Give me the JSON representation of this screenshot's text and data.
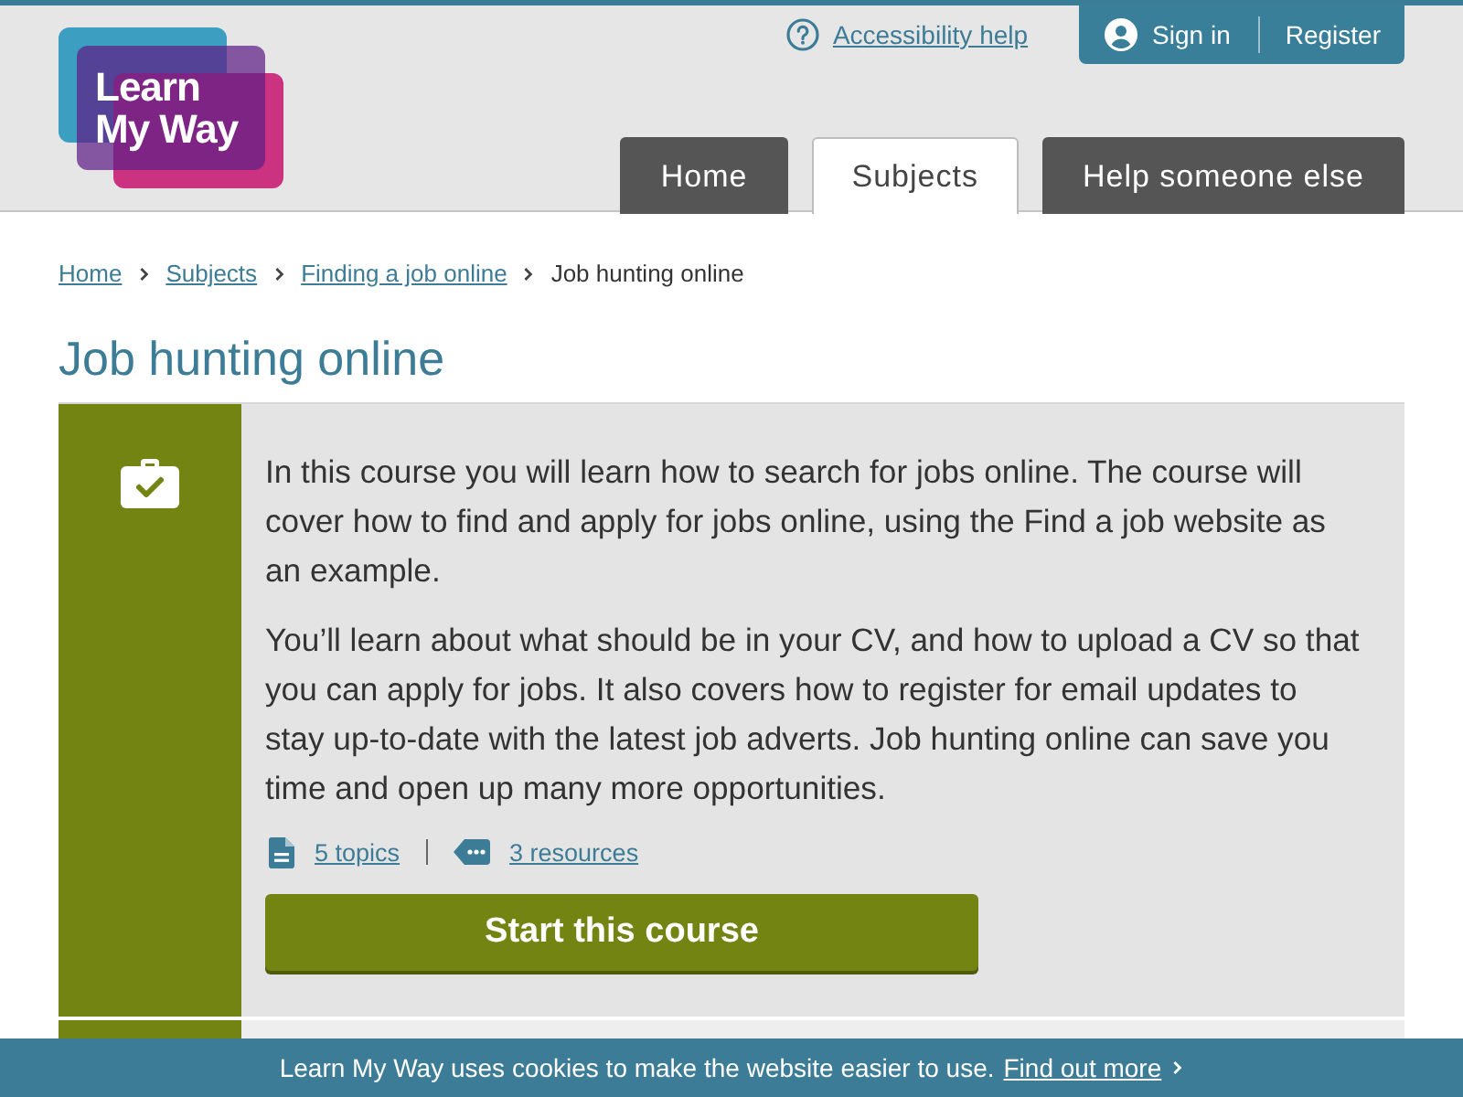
{
  "header": {
    "logo": {
      "lines": [
        "Learn",
        "My Way"
      ]
    },
    "accessibility_link": "Accessibility help",
    "account": {
      "sign_in": "Sign in",
      "register": "Register"
    }
  },
  "nav_tabs": [
    {
      "label": "Home",
      "selected": false
    },
    {
      "label": "Subjects",
      "selected": true
    },
    {
      "label": "Help someone else",
      "selected": false
    }
  ],
  "breadcrumb": [
    {
      "label": "Home",
      "current": false
    },
    {
      "label": "Subjects",
      "current": false
    },
    {
      "label": "Finding a job online",
      "current": false
    },
    {
      "label": "Job hunting online",
      "current": true
    }
  ],
  "page_title": "Job hunting online",
  "course": {
    "paragraphs": [
      "In this course you will learn how to search for jobs online. The course will cover how to find and apply for jobs online, using the Find a job website as an example.",
      "You’ll learn about what should be in your CV, and how to upload a CV so that you can apply for jobs. It also covers how to register for email updates to stay up-to-date with the latest job adverts. Job hunting online can save you time and open up many more opportunities."
    ],
    "topics_link": "5 topics",
    "resources_link": "3 resources",
    "start_button": "Start this course"
  },
  "cookie_banner": {
    "message": "Learn My Way uses cookies to make the website easier to use.",
    "link": "Find out more"
  }
}
